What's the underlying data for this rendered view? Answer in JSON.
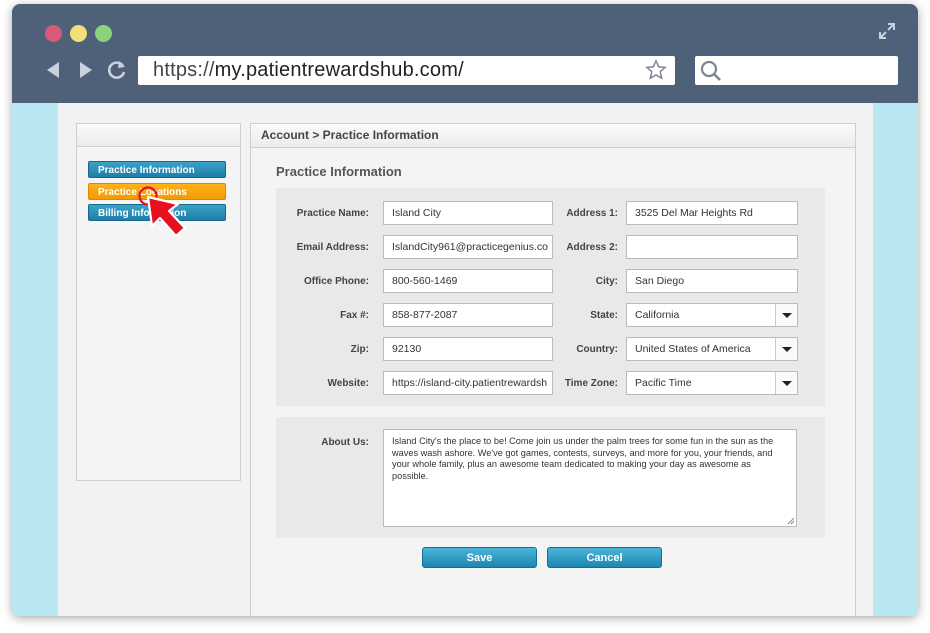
{
  "browser": {
    "url_prefix": "https://",
    "url_domain": "my.patientrewardshub.com/",
    "search_placeholder": ""
  },
  "sidebar": {
    "items": [
      {
        "label": "Practice Information",
        "style": "blue"
      },
      {
        "label": "Practice Locations",
        "style": "orange"
      },
      {
        "label": "Billing Information",
        "style": "blue"
      }
    ]
  },
  "breadcrumb": "Account > Practice Information",
  "section_title": "Practice Information",
  "form": {
    "practice_name": {
      "label": "Practice Name:",
      "value": "Island City"
    },
    "email": {
      "label": "Email Address:",
      "value": "IslandCity961@practicegenius.co"
    },
    "office_phone": {
      "label": "Office Phone:",
      "value": "800-560-1469"
    },
    "fax": {
      "label": "Fax #:",
      "value": "858-877-2087"
    },
    "zip": {
      "label": "Zip:",
      "value": "92130"
    },
    "website": {
      "label": "Website:",
      "value": "https://island-city.patientrewardsh"
    },
    "address1": {
      "label": "Address 1:",
      "value": "3525 Del Mar Heights Rd"
    },
    "address2": {
      "label": "Address 2:",
      "value": ""
    },
    "city": {
      "label": "City:",
      "value": "San Diego"
    },
    "state": {
      "label": "State:",
      "value": "California"
    },
    "country": {
      "label": "Country:",
      "value": "United States of America"
    },
    "timezone": {
      "label": "Time Zone:",
      "value": "Pacific Time"
    }
  },
  "about": {
    "label": "About Us:",
    "value": "Island City's the place to be! Come join us under the palm trees for some fun in the sun as the waves wash ashore. We've got games, contests, surveys, and more for you, your friends, and your whole family, plus an awesome team dedicated to making your day as awesome as possible."
  },
  "actions": {
    "save": "Save",
    "cancel": "Cancel"
  },
  "colors": {
    "chrome": "#4f6079",
    "page_bg": "#b8e7f1",
    "button_blue": "#2a93bd",
    "button_orange": "#f7a40c",
    "cursor_red": "#e8101f"
  },
  "icons": [
    "expand-icon",
    "back-arrow-icon",
    "forward-arrow-icon",
    "reload-icon",
    "star-icon",
    "search-icon",
    "cursor-arrow-icon",
    "chevron-down-icon"
  ]
}
